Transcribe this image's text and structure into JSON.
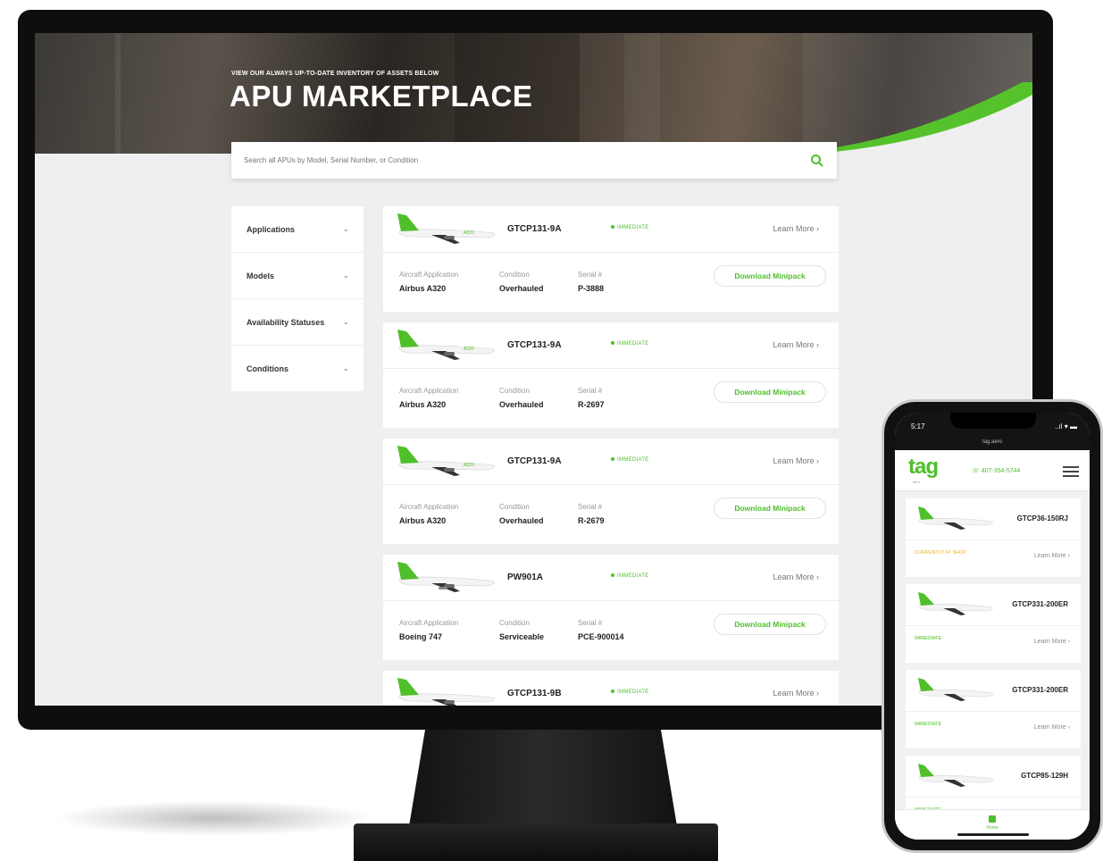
{
  "desktop": {
    "hero": {
      "kicker": "VIEW OUR ALWAYS UP-TO-DATE INVENTORY OF ASSETS BELOW",
      "title": "APU MARKETPLACE"
    },
    "search": {
      "placeholder": "Search all APUs by Model, Serial Number, or Condition"
    },
    "filters": [
      {
        "label": "Applications"
      },
      {
        "label": "Models"
      },
      {
        "label": "Availability Statuses"
      },
      {
        "label": "Conditions"
      }
    ],
    "meta_labels": {
      "application": "Aircraft Application",
      "condition": "Condition",
      "serial": "Serial #"
    },
    "learn_more": "Learn More",
    "download_label": "Download Minipack",
    "listings": [
      {
        "model": "GTCP131-9A",
        "status": "IMMEDIATE",
        "application": "Airbus A320",
        "condition": "Overhauled",
        "serial": "P-3888"
      },
      {
        "model": "GTCP131-9A",
        "status": "IMMEDIATE",
        "application": "Airbus A320",
        "condition": "Overhauled",
        "serial": "R-2697"
      },
      {
        "model": "GTCP131-9A",
        "status": "IMMEDIATE",
        "application": "Airbus A320",
        "condition": "Overhauled",
        "serial": "R-2679"
      },
      {
        "model": "PW901A",
        "status": "IMMEDIATE",
        "application": "Boeing 747",
        "condition": "Serviceable",
        "serial": "PCE-900014"
      },
      {
        "model": "GTCP131-9B",
        "status": "IMMEDIATE"
      }
    ]
  },
  "mobile": {
    "status_time": "5:17",
    "status_right": "..ıl ▾ ▬",
    "url": "tag.aero",
    "logo": "tag",
    "logo_sub": "aero",
    "phone": "407-354-5744",
    "learn_more": "Learn More",
    "tab_label": "Home",
    "listings": [
      {
        "model": "GTCP36-150RJ",
        "status": "CURRENTLY AT SHOP",
        "warn": true
      },
      {
        "model": "GTCP331-200ER",
        "status": "IMMEDIATE"
      },
      {
        "model": "GTCP331-200ER",
        "status": "IMMEDIATE"
      },
      {
        "model": "GTCP85-129H",
        "status": "IMMEDIATE"
      }
    ]
  },
  "colors": {
    "accent": "#4fbf2a",
    "warning": "#f0b21a",
    "bezel": "#0e0e0e",
    "page_bg": "#efefef"
  },
  "icons": [
    "search-icon",
    "chevron-down-icon",
    "chevron-right-icon",
    "airplane-icon",
    "menu-icon",
    "phone-icon",
    "home-icon"
  ]
}
